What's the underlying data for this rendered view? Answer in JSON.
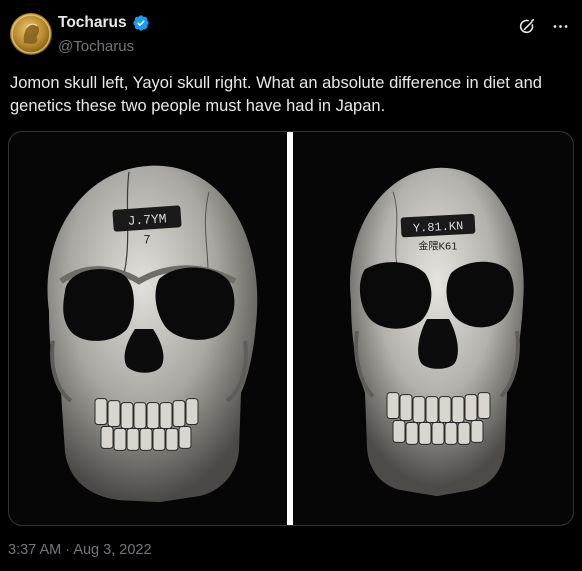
{
  "author": {
    "display_name": "Tocharus",
    "handle": "@Tocharus",
    "verified": true,
    "avatar_icon": "gold-coin-avatar"
  },
  "tweet": {
    "text": "Jomon skull left, Yayoi skull right. What an absolute difference in diet and genetics these two people must have had in Japan.",
    "time": "3:37 AM",
    "separator": "·",
    "date": "Aug 3, 2022"
  },
  "media": {
    "left_label": "J.7YM",
    "left_sublabel": "7",
    "right_label": "Y.81.KN",
    "right_sublabel": "金隈K61"
  },
  "colors": {
    "background": "#000000",
    "text": "#e7e9ea",
    "secondary": "#71767b",
    "verified": "#1d9bf0"
  }
}
